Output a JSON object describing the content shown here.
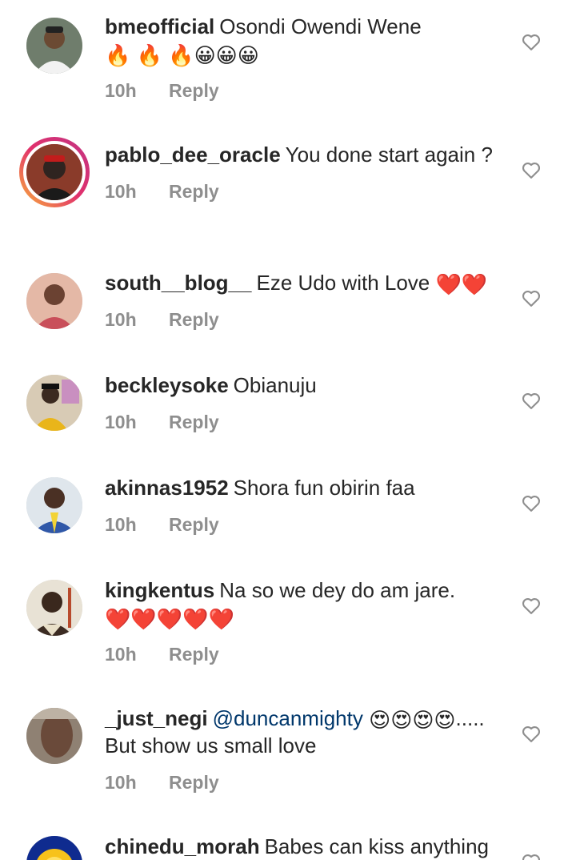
{
  "comments": [
    {
      "user": "bmeofficial",
      "text": "Osondi Owendi Wene",
      "emoji": "🔥 🔥 🔥😀😀😀",
      "time": "10h",
      "reply": "Reply"
    },
    {
      "user": "pablo_dee_oracle",
      "text": "You done start again ?",
      "emoji": "",
      "time": "10h",
      "reply": "Reply"
    },
    {
      "user": "south__blog__",
      "text": "Eze Udo with Love",
      "emoji": "❤️❤️",
      "time": "10h",
      "reply": "Reply"
    },
    {
      "user": "beckleysoke",
      "text": "Obianuju",
      "emoji": "",
      "time": "10h",
      "reply": "Reply"
    },
    {
      "user": "akinnas1952",
      "text": "Shora fun obirin faa",
      "emoji": "",
      "time": "10h",
      "reply": "Reply"
    },
    {
      "user": "kingkentus",
      "text": "Na so we dey do am jare.",
      "emoji": "❤️❤️❤️❤️❤️",
      "time": "10h",
      "reply": "Reply"
    },
    {
      "user": "_just_negi",
      "mention": "@duncanmighty",
      "emoji": "😍😍😍😍",
      "text": "..... But show us small love",
      "time": "10h",
      "reply": "Reply"
    },
    {
      "user": "chinedu_morah",
      "text": "Babes can kiss anything",
      "emoji": "",
      "time": "",
      "reply": ""
    }
  ]
}
